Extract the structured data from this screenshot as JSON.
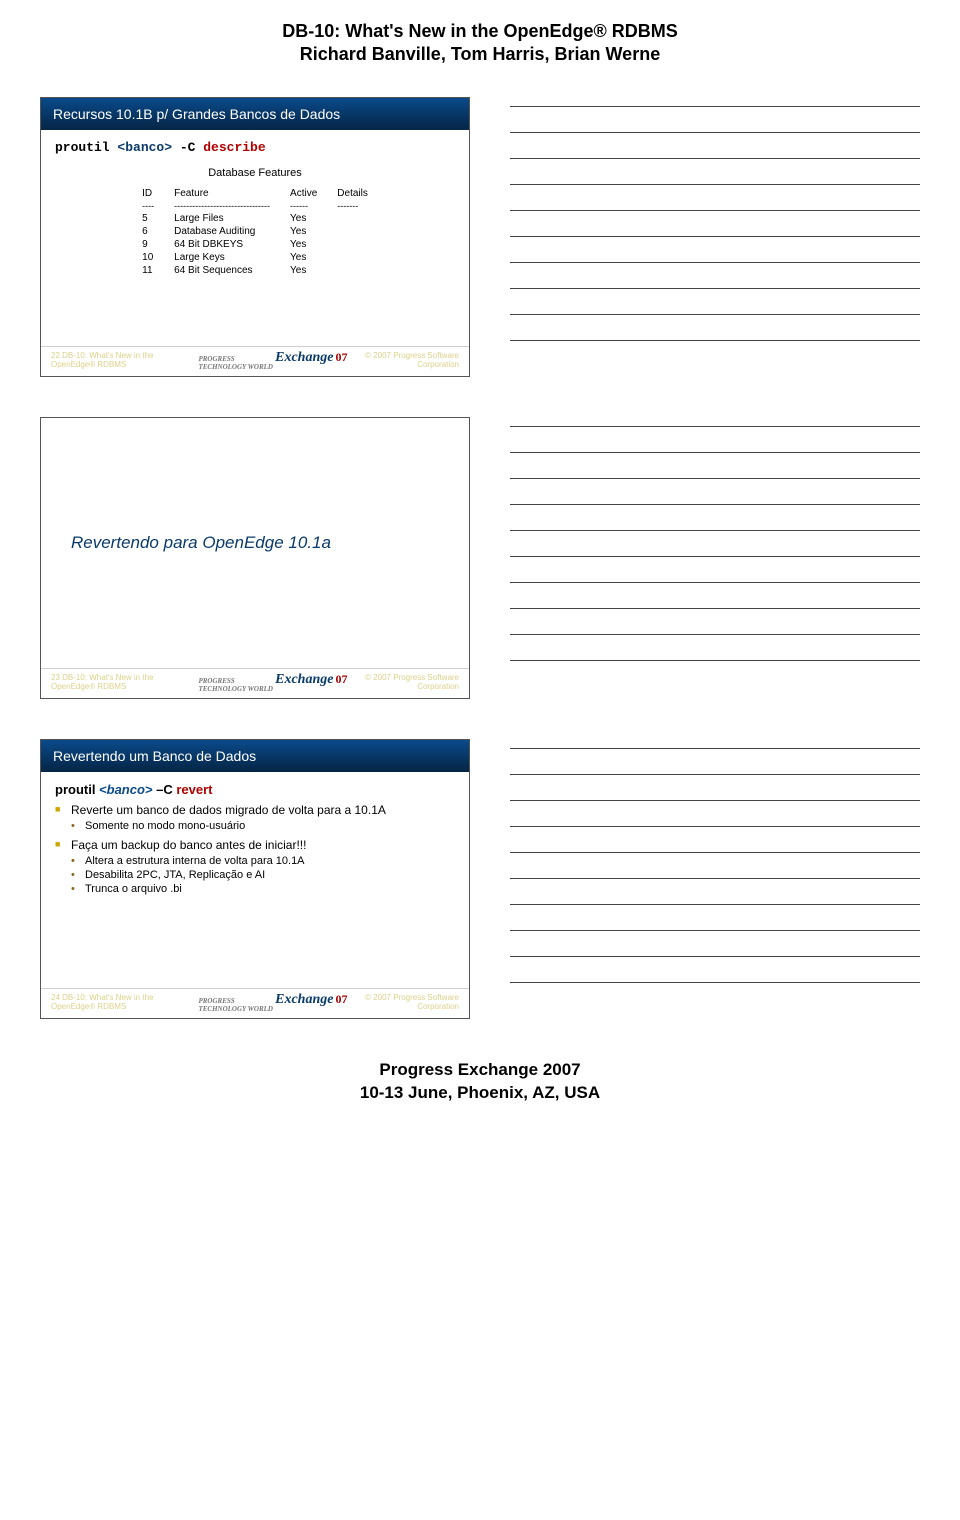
{
  "header": {
    "title1": "DB-10: What's New in the OpenEdge® RDBMS",
    "title2": "Richard Banville, Tom Harris, Brian Werne"
  },
  "slide22": {
    "title": "Recursos 10.1B p/ Grandes Bancos de Dados",
    "cmd_prefix": "proutil ",
    "cmd_arg": "<banco>",
    "cmd_flag": " -C ",
    "cmd_action": "describe",
    "features_title": "Database Features",
    "cols": [
      "ID",
      "Feature",
      "Active",
      "Details"
    ],
    "sep": [
      "----",
      "--------------------------------",
      "------",
      "-------"
    ],
    "rows": [
      {
        "id": "5",
        "feature": "Large Files",
        "active": "Yes",
        "details": ""
      },
      {
        "id": "6",
        "feature": "Database Auditing",
        "active": "Yes",
        "details": ""
      },
      {
        "id": "9",
        "feature": "64 Bit DBKEYS",
        "active": "Yes",
        "details": ""
      },
      {
        "id": "10",
        "feature": "Large Keys",
        "active": "Yes",
        "details": ""
      },
      {
        "id": "11",
        "feature": "64 Bit Sequences",
        "active": "Yes",
        "details": ""
      }
    ],
    "footer_left": "22  DB-10: What's New in the OpenEdge® RDBMS",
    "footer_right": "© 2007 Progress Software Corporation"
  },
  "slide23": {
    "title": "Revertendo para OpenEdge 10.1a",
    "footer_left": "23  DB-10: What's New in the OpenEdge® RDBMS",
    "footer_right": "© 2007 Progress Software Corporation"
  },
  "slide24": {
    "title": "Revertendo um Banco de Dados",
    "cmd_black1": "proutil ",
    "cmd_blue1": "<banco>",
    "cmd_black2": " –C ",
    "cmd_red": "revert",
    "b1": "Reverte um banco de dados migrado de volta para a 10.1A",
    "b1s1": "Somente no modo mono-usuário",
    "b2": "Faça um backup do banco antes de iniciar!!!",
    "b2s1": "Altera a estrutura interna de volta para 10.1A",
    "b2s2": "Desabilita 2PC, JTA, Replicação e AI",
    "b2s3": "Trunca o arquivo .bi",
    "footer_left": "24  DB-10: What's New in the OpenEdge® RDBMS",
    "footer_right": "© 2007 Progress Software Corporation"
  },
  "logo": {
    "text": "Exchange",
    "badge": "07",
    "sup": "PROGRESS TECHNOLOGY WORLD"
  },
  "footer": {
    "line1": "Progress Exchange 2007",
    "line2": "10-13 June, Phoenix, AZ, USA"
  }
}
